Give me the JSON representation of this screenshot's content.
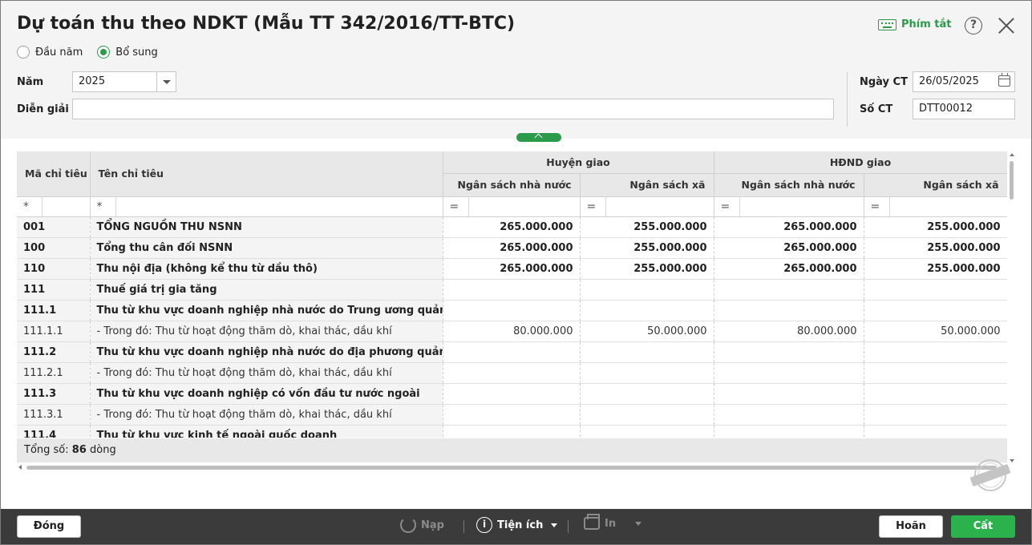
{
  "dialog": {
    "title": "Dự toán thu theo NDKT (Mẫu TT 342/2016/TT-BTC)",
    "shortcut_label": "Phím tắt",
    "help_label": "?"
  },
  "radios": [
    {
      "label": "Đầu năm",
      "checked": false
    },
    {
      "label": "Bổ sung",
      "checked": true
    }
  ],
  "form": {
    "nam_label": "Năm",
    "nam_value": "2025",
    "dien_giai_label": "Diễn giải",
    "dien_giai_value": "",
    "ngay_ct_label": "Ngày CT",
    "ngay_ct_value": "26/05/2025",
    "so_ct_label": "Số CT",
    "so_ct_value": "DTT00012"
  },
  "grid": {
    "headers": {
      "ma_chi_tieu": "Mã chỉ tiêu",
      "ten_chi_tieu": "Tên chỉ tiêu",
      "huyen_giao": "Huyện giao",
      "hdnd_giao": "HĐND giao",
      "ngan_sach_nha_nuoc": "Ngân sách nhà nước",
      "ngan_sach_xa": "Ngân sách xã"
    },
    "filter": {
      "text_op": "*",
      "num_op": "="
    },
    "rows": [
      {
        "code": "001",
        "name": "TỔNG NGUỒN THU NSNN",
        "bold": true,
        "v1": "265.000.000",
        "v2": "255.000.000",
        "v3": "265.000.000",
        "v4": "255.000.000"
      },
      {
        "code": "100",
        "name": "Tổng thu cân đối NSNN",
        "bold": true,
        "v1": "265.000.000",
        "v2": "255.000.000",
        "v3": "265.000.000",
        "v4": "255.000.000"
      },
      {
        "code": "110",
        "name": "Thu nội địa (không kể thu từ dầu thô)",
        "bold": true,
        "v1": "265.000.000",
        "v2": "255.000.000",
        "v3": "265.000.000",
        "v4": "255.000.000"
      },
      {
        "code": "111",
        "name": "Thuế giá trị gia tăng",
        "bold": true,
        "v1": "",
        "v2": "",
        "v3": "",
        "v4": ""
      },
      {
        "code": "111.1",
        "name": "Thu từ khu vực doanh nghiệp nhà nước do Trung ương quản lý",
        "bold": true,
        "v1": "",
        "v2": "",
        "v3": "",
        "v4": ""
      },
      {
        "code": "111.1.1",
        "name": "- Trong đó: Thu từ hoạt động thăm dò, khai thác, dầu khí",
        "bold": false,
        "v1": "80.000.000",
        "v2": "50.000.000",
        "v3": "80.000.000",
        "v4": "50.000.000"
      },
      {
        "code": "111.2",
        "name": "Thu từ khu vực doanh nghiệp nhà nước do địa phương quản lý",
        "bold": true,
        "v1": "",
        "v2": "",
        "v3": "",
        "v4": ""
      },
      {
        "code": "111.2.1",
        "name": "- Trong đó: Thu từ hoạt động thăm dò, khai thác, dầu khí",
        "bold": false,
        "v1": "",
        "v2": "",
        "v3": "",
        "v4": ""
      },
      {
        "code": "111.3",
        "name": "Thu từ khu vực doanh nghiệp có vốn đầu tư nước ngoài",
        "bold": true,
        "v1": "",
        "v2": "",
        "v3": "",
        "v4": ""
      },
      {
        "code": "111.3.1",
        "name": "- Trong đó: Thu từ hoạt động thăm dò, khai thác, dầu khí",
        "bold": false,
        "v1": "",
        "v2": "",
        "v3": "",
        "v4": ""
      },
      {
        "code": "111.4",
        "name": "Thu từ khu vực kinh tế ngoài quốc doanh",
        "bold": true,
        "v1": "",
        "v2": "",
        "v3": "",
        "v4": ""
      }
    ],
    "total_prefix": "Tổng số:",
    "total_count": "86",
    "total_suffix": "dòng"
  },
  "watermark": "DỮ LIỆU MẪU",
  "toolbar": {
    "close_label": "Đóng",
    "reload_label": "Nạp",
    "utility_label": "Tiện ích",
    "print_label": "In",
    "cancel_label": "Hoãn",
    "save_label": "Cất"
  },
  "colors": {
    "accent": "#2b9a4a",
    "save_button": "#2bb24c",
    "bottom_bar": "#3b3b3b"
  }
}
